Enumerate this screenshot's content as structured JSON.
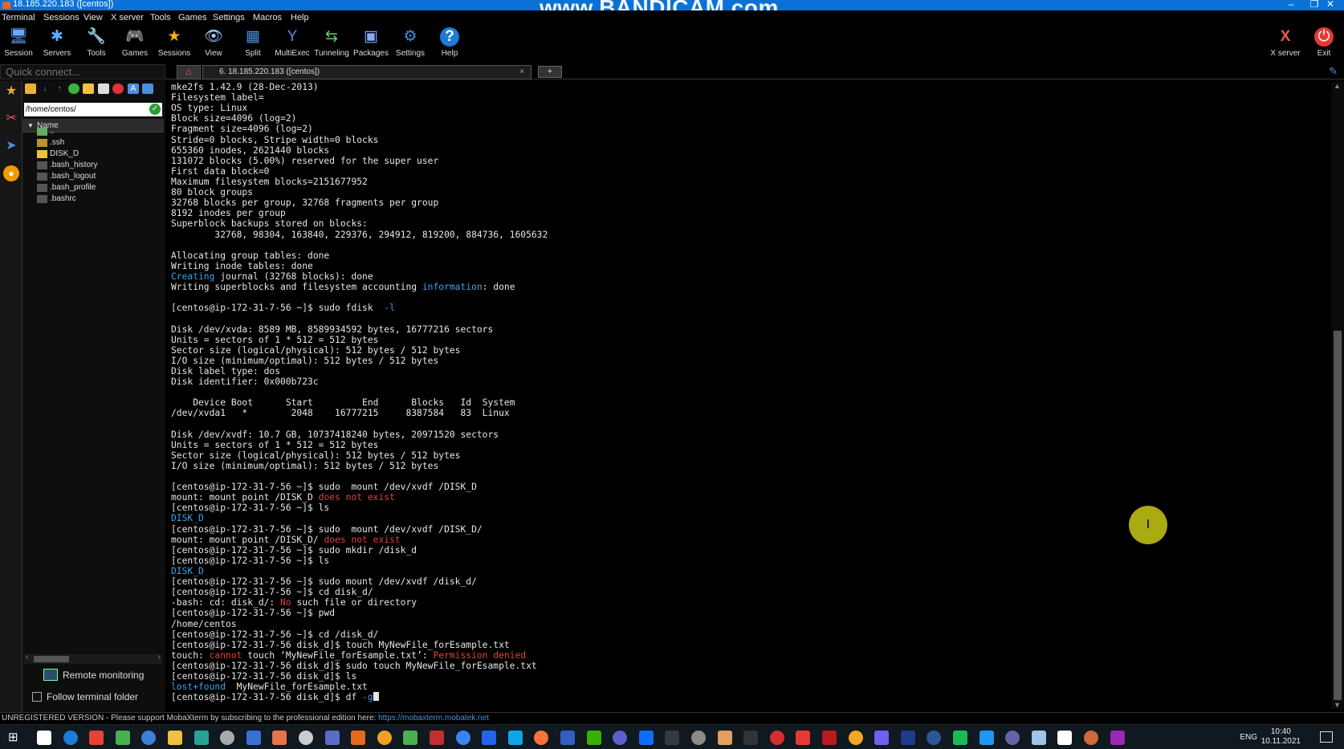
{
  "window": {
    "title": "18.185.220.183 ([centos])",
    "watermark": "www.BANDICAM.com",
    "controls": [
      "–",
      "❐",
      "✕"
    ]
  },
  "menu": [
    "Terminal",
    "Sessions",
    "View",
    "X server",
    "Tools",
    "Games",
    "Settings",
    "Macros",
    "Help"
  ],
  "toolbar": {
    "buttons": [
      {
        "label": "Session",
        "icon": "session-icon",
        "glyph": "🖥"
      },
      {
        "label": "Servers",
        "icon": "servers-icon",
        "glyph": "✱"
      },
      {
        "label": "Tools",
        "icon": "tools-icon",
        "glyph": "🔧"
      },
      {
        "label": "Games",
        "icon": "games-icon",
        "glyph": "🎮"
      },
      {
        "label": "Sessions",
        "icon": "star-icon",
        "glyph": "★"
      },
      {
        "label": "View",
        "icon": "view-icon",
        "glyph": "👁"
      },
      {
        "label": "Split",
        "icon": "split-icon",
        "glyph": "▦"
      },
      {
        "label": "MultiExec",
        "icon": "multiexec-icon",
        "glyph": "Y"
      },
      {
        "label": "Tunneling",
        "icon": "tunneling-icon",
        "glyph": "⇆"
      },
      {
        "label": "Packages",
        "icon": "packages-icon",
        "glyph": "▣"
      },
      {
        "label": "Settings",
        "icon": "settings-icon",
        "glyph": "⚙"
      },
      {
        "label": "Help",
        "icon": "help-icon",
        "glyph": "?"
      }
    ],
    "right": [
      {
        "label": "X server",
        "icon": "xserver-icon",
        "glyph": "X"
      },
      {
        "label": "Exit",
        "icon": "exit-icon",
        "glyph": "⏻"
      }
    ]
  },
  "quick_connect": {
    "placeholder": "Quick connect..."
  },
  "tabs": {
    "home_glyph": "⌂",
    "session": "6. 18.185.220.183 ([centos])",
    "close": "×",
    "new": "+"
  },
  "sidebar": {
    "path": "/home/centos/",
    "column": "Name",
    "files": [
      "..",
      ".ssh",
      "DISK_D",
      ".bash_history",
      ".bash_logout",
      ".bash_profile",
      ".bashrc"
    ],
    "remote_monitoring": "Remote monitoring",
    "follow_folder": "Follow terminal folder"
  },
  "terminal": {
    "lines": [
      [
        {
          "t": "mke2fs 1.42.9 (28-Dec-2013)"
        }
      ],
      [
        {
          "t": "Filesystem label="
        }
      ],
      [
        {
          "t": "OS type: Linux"
        }
      ],
      [
        {
          "t": "Block size=4096 (log=2)"
        }
      ],
      [
        {
          "t": "Fragment size=4096 (log=2)"
        }
      ],
      [
        {
          "t": "Stride=0 blocks, Stripe width=0 blocks"
        }
      ],
      [
        {
          "t": "655360 inodes, 2621440 blocks"
        }
      ],
      [
        {
          "t": "131072 blocks (5.00%) reserved for the super user"
        }
      ],
      [
        {
          "t": "First data block=0"
        }
      ],
      [
        {
          "t": "Maximum filesystem blocks=2151677952"
        }
      ],
      [
        {
          "t": "80 block groups"
        }
      ],
      [
        {
          "t": "32768 blocks per group, 32768 fragments per group"
        }
      ],
      [
        {
          "t": "8192 inodes per group"
        }
      ],
      [
        {
          "t": "Superblock backups stored on blocks:"
        }
      ],
      [
        {
          "t": "        32768, 98304, 163840, 229376, 294912, 819200, 884736, 1605632"
        }
      ],
      [
        {
          "t": ""
        }
      ],
      [
        {
          "t": "Allocating group tables: done"
        }
      ],
      [
        {
          "t": "Writing inode tables: done"
        }
      ],
      [
        {
          "t": "Creating",
          "c": "blue"
        },
        {
          "t": " journal (32768 blocks): done"
        }
      ],
      [
        {
          "t": "Writing superblocks and filesystem accounting "
        },
        {
          "t": "information",
          "c": "blue"
        },
        {
          "t": ": done"
        }
      ],
      [
        {
          "t": ""
        }
      ],
      [
        {
          "t": "[centos@ip-172-31-7-56 ~]$ sudo fdisk  "
        },
        {
          "t": "-l",
          "c": "blue"
        }
      ],
      [
        {
          "t": ""
        }
      ],
      [
        {
          "t": "Disk /dev/xvda: 8589 MB, 8589934592 bytes, 16777216 sectors"
        }
      ],
      [
        {
          "t": "Units = sectors of 1 * 512 = 512 bytes"
        }
      ],
      [
        {
          "t": "Sector size (logical/physical): 512 bytes / 512 bytes"
        }
      ],
      [
        {
          "t": "I/O size (minimum/optimal): 512 bytes / 512 bytes"
        }
      ],
      [
        {
          "t": "Disk label type: dos"
        }
      ],
      [
        {
          "t": "Disk identifier: 0x000b723c"
        }
      ],
      [
        {
          "t": ""
        }
      ],
      [
        {
          "t": "    Device Boot      Start         End      Blocks   Id  System"
        }
      ],
      [
        {
          "t": "/dev/xvda1   *        2048    16777215     8387584   83  Linux"
        }
      ],
      [
        {
          "t": ""
        }
      ],
      [
        {
          "t": "Disk /dev/xvdf: 10.7 GB, 10737418240 bytes, 20971520 sectors"
        }
      ],
      [
        {
          "t": "Units = sectors of 1 * 512 = 512 bytes"
        }
      ],
      [
        {
          "t": "Sector size (logical/physical): 512 bytes / 512 bytes"
        }
      ],
      [
        {
          "t": "I/O size (minimum/optimal): 512 bytes / 512 bytes"
        }
      ],
      [
        {
          "t": ""
        }
      ],
      [
        {
          "t": "[centos@ip-172-31-7-56 ~]$ sudo  mount /dev/xvdf /DISK_D"
        }
      ],
      [
        {
          "t": "mount: mount point /DISK_D "
        },
        {
          "t": "does not exist",
          "c": "red"
        }
      ],
      [
        {
          "t": "[centos@ip-172-31-7-56 ~]$ ls"
        }
      ],
      [
        {
          "t": "DISK_D",
          "c": "blue"
        }
      ],
      [
        {
          "t": "[centos@ip-172-31-7-56 ~]$ sudo  mount /dev/xvdf /DISK_D/"
        }
      ],
      [
        {
          "t": "mount: mount point /DISK_D/ "
        },
        {
          "t": "does not exist",
          "c": "red"
        }
      ],
      [
        {
          "t": "[centos@ip-172-31-7-56 ~]$ sudo mkdir /disk_d"
        }
      ],
      [
        {
          "t": "[centos@ip-172-31-7-56 ~]$ ls"
        }
      ],
      [
        {
          "t": "DISK_D",
          "c": "blue"
        }
      ],
      [
        {
          "t": "[centos@ip-172-31-7-56 ~]$ sudo mount /dev/xvdf /disk_d/"
        }
      ],
      [
        {
          "t": "[centos@ip-172-31-7-56 ~]$ cd disk_d/"
        }
      ],
      [
        {
          "t": "-bash: cd: disk_d/: "
        },
        {
          "t": "No",
          "c": "red"
        },
        {
          "t": " such file or directory"
        }
      ],
      [
        {
          "t": "[centos@ip-172-31-7-56 ~]$ pwd"
        }
      ],
      [
        {
          "t": "/home/centos"
        }
      ],
      [
        {
          "t": "[centos@ip-172-31-7-56 ~]$ cd /disk_d/"
        }
      ],
      [
        {
          "t": "[centos@ip-172-31-7-56 disk_d]$ touch MyNewFile_forEsample.txt"
        }
      ],
      [
        {
          "t": "touch: "
        },
        {
          "t": "cannot",
          "c": "red"
        },
        {
          "t": " touch ‘MyNewFile_forEsample.txt’: "
        },
        {
          "t": "Permission denied",
          "c": "red"
        }
      ],
      [
        {
          "t": "[centos@ip-172-31-7-56 disk_d]$ sudo touch MyNewFile_forEsample.txt"
        }
      ],
      [
        {
          "t": "[centos@ip-172-31-7-56 disk_d]$ ls"
        }
      ],
      [
        {
          "t": "lost+found",
          "c": "blue"
        },
        {
          "t": "  MyNewFile_forEsample.txt"
        }
      ],
      [
        {
          "t": "[centos@ip-172-31-7-56 disk_d]$ df "
        },
        {
          "t": "-g",
          "c": "blue"
        }
      ]
    ]
  },
  "cursor_glyph": "I",
  "status": {
    "text": "UNREGISTERED VERSION  -  Please support MobaXterm by subscribing to the professional edition here: ",
    "link": "https://mobaxterm.mobatek.net"
  },
  "taskbar": {
    "lang": "ENG",
    "time": "10:40",
    "date": "10.11.2021",
    "app_colors": [
      "#ffffff",
      "#1e7bd6",
      "#e94235",
      "#4caf50",
      "#3b7fd8",
      "#f0c040",
      "#2aa198",
      "#aaaaaa",
      "#3a6fd8",
      "#e8734a",
      "#cccccc",
      "#5b6bc8",
      "#e36a1e",
      "#f0a020",
      "#4caf50",
      "#c03030",
      "#3b82f6",
      "#2563eb",
      "#0ea5e9",
      "#ff7139",
      "#3060c0",
      "#38b000",
      "#5b5fc7",
      "#0d6efd",
      "#3a3a3a",
      "#8a8a8a",
      "#e0a060",
      "#333333",
      "#d32f2f",
      "#e53935",
      "#b71c1c",
      "#f5a623",
      "#7360f2",
      "#1e3a8a",
      "#2b5797",
      "#1db954",
      "#2196f3",
      "#6264a7",
      "#a0c4e8",
      "#ffffff",
      "#cf6a3a",
      "#9c27b0"
    ]
  }
}
